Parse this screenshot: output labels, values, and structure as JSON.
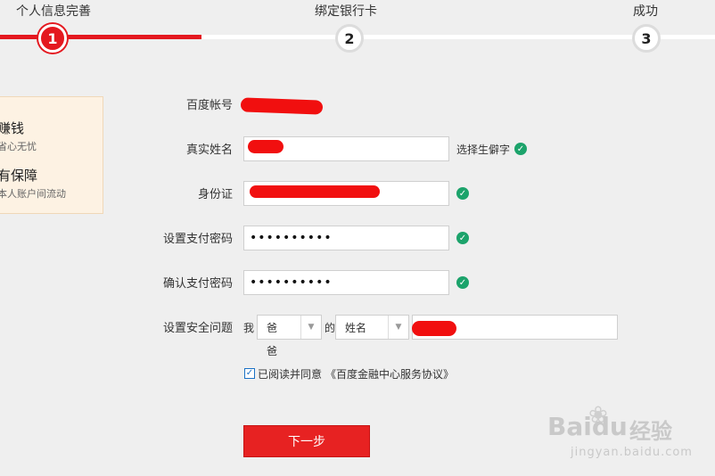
{
  "steps": [
    {
      "label": "个人信息完善",
      "number": "1"
    },
    {
      "label": "绑定银行卡",
      "number": "2"
    },
    {
      "label": "成功",
      "number": "3"
    }
  ],
  "info_panel": {
    "item1_title": "赚钱",
    "item1_sub": "省心无忧",
    "item2_title": "有保障",
    "item2_sub": "本人账户间流动"
  },
  "form": {
    "account_label": "百度帐号",
    "realname_label": "真实姓名",
    "realname_value": "",
    "realname_link": "选择生僻字",
    "idcard_label": "身份证",
    "pay_pwd_label": "设置支付密码",
    "pay_pwd_value": "••••••••••",
    "confirm_pwd_label": "确认支付密码",
    "confirm_pwd_value": "••••••••••",
    "security_label": "设置安全问题",
    "security_prefix": "我",
    "security_select1": "爸",
    "security_select1_wrap": "爸",
    "security_mid": "的",
    "security_select2": "姓名",
    "agree_text": "已阅读并同意",
    "agree_link": "《百度金融中心服务协议》"
  },
  "next_button": "下一步",
  "watermark": {
    "brand": "Baidu",
    "cn": "经验",
    "url": "jingyan.baidu.com"
  },
  "colors": {
    "accent": "#e4181f",
    "link": "#1b72c6",
    "check": "#1ca36b"
  }
}
